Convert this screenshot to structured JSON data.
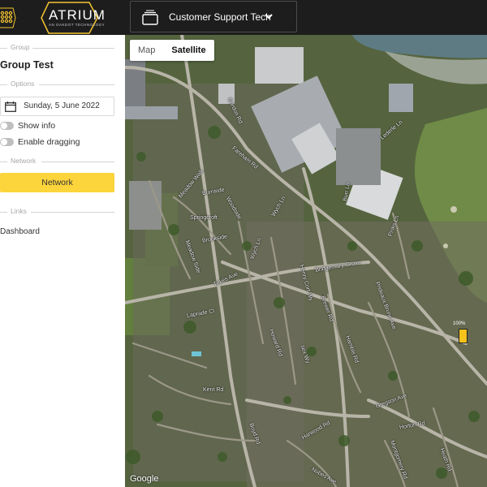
{
  "header": {
    "logo_text": "ATRIUM",
    "logo_subtext": "AN OAKDOT TECHNOLOGY",
    "site_name": "Customer Support Tech",
    "accent_color": "#f4c531"
  },
  "sidebar": {
    "group_section": "Group",
    "group_name": "Group Test",
    "options_section": "Options",
    "date": "Sunday, 5 June 2022",
    "show_info": "Show info",
    "enable_dragging": "Enable dragging",
    "network_section": "Network",
    "network_button": "Network",
    "links_section": "Links",
    "dashboard_link": "Dashboard"
  },
  "map": {
    "type_map": "Map",
    "type_satellite": "Satellite",
    "active_type": "Satellite",
    "attribution": "Google",
    "marker_label": "100%",
    "marker_color": "#f6c31c",
    "road_labels": {
      "r1": "Fareham Rd",
      "r2": "Gordon Rd",
      "r3": "Meadow Walk",
      "r4": "Springcroft",
      "r5": "Burnside",
      "r6": "Brookside",
      "r7": "Woodside",
      "r8": "Meadow Side",
      "r9": "Tukes Ave",
      "r10": "Bridgemary Grove",
      "r11": "Henry Cort Wy",
      "r12": "Laprade Cl",
      "r13": "Kent Rd",
      "r14": "Wych Ln",
      "r15": "Gregson Ave",
      "r16": "Horton Rd",
      "r17": "Harwood Rd",
      "r18": "Boyd Rd",
      "r19": "Nobes Ave",
      "r20": "Lederle Ln",
      "r21": "Pinks Ln",
      "r22": "Burr Ln",
      "r23": "Montgomery Rd",
      "r24": "Prideaux Brune Ave",
      "r25": "Heath Rd",
      "r26": "Wych Ln",
      "r27": "Brewer Rd",
      "r28": "Ilex Wy",
      "r29": "Hamble Rd",
      "r30": "Howard Rd"
    }
  }
}
